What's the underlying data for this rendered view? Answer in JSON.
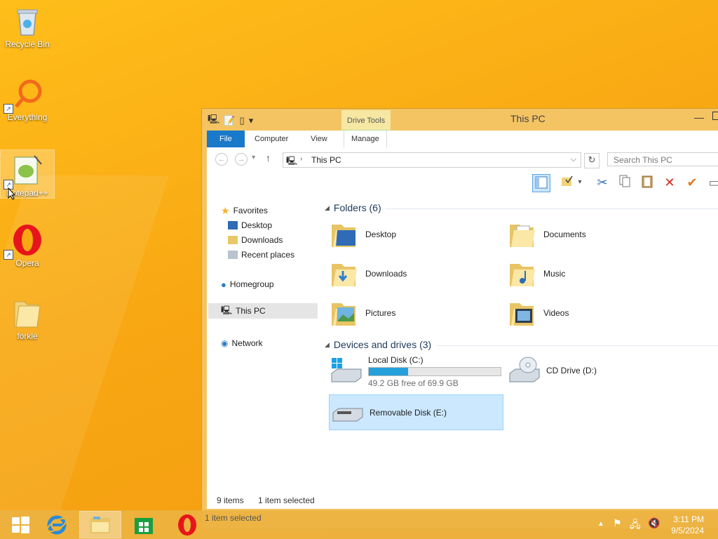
{
  "desktop": {
    "icons": [
      {
        "label": "Recycle Bin",
        "icon": "recycle-bin-icon"
      },
      {
        "label": "Everything",
        "icon": "everything-search-icon"
      },
      {
        "label": "Notepad++",
        "icon": "notepad-plus-plus-icon"
      },
      {
        "label": "Opera",
        "icon": "opera-icon"
      },
      {
        "label": "forkle",
        "icon": "folder-icon"
      }
    ]
  },
  "window": {
    "title": "This PC",
    "contextual_tab_group": "Drive Tools",
    "tabs": [
      {
        "label": "File"
      },
      {
        "label": "Computer"
      },
      {
        "label": "View"
      },
      {
        "label": "Manage"
      }
    ],
    "address": {
      "path": "This PC"
    },
    "search": {
      "placeholder": "Search This PC"
    },
    "navpane": {
      "favorites": "Favorites",
      "favorite_items": [
        "Desktop",
        "Downloads",
        "Recent places"
      ],
      "homegroup": "Homegroup",
      "this_pc": "This PC",
      "network": "Network"
    },
    "folders_header": "Folders (6)",
    "folders": [
      {
        "name": "Desktop"
      },
      {
        "name": "Documents"
      },
      {
        "name": "Downloads"
      },
      {
        "name": "Music"
      },
      {
        "name": "Pictures"
      },
      {
        "name": "Videos"
      }
    ],
    "devices_header": "Devices and drives (3)",
    "drives": [
      {
        "name": "Local Disk (C:)",
        "free_text": "49.2 GB free of 69.9 GB",
        "used_fraction": 0.296
      },
      {
        "name": "CD Drive (D:)"
      },
      {
        "name": "Removable Disk (E:)",
        "selected": true
      }
    ],
    "status": {
      "items": "9 items",
      "selected": "1 item selected"
    }
  },
  "taskbar": {
    "apps": [
      "start-icon",
      "internet-explorer-icon",
      "file-explorer-icon",
      "store-icon",
      "opera-icon"
    ],
    "peek_status": "1 item selected",
    "time": "3:11 PM",
    "date": "9/5/2024"
  },
  "colors": {
    "accent": "#1979ca",
    "selection": "#cce8ff",
    "wallpaper": "#f8a813"
  }
}
